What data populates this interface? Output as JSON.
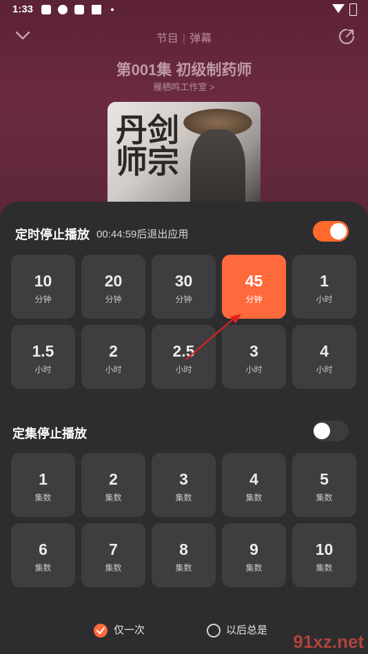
{
  "status_bar": {
    "time": "1:33"
  },
  "header": {
    "tabs": [
      "节目",
      "弹幕"
    ],
    "episode_title": "第001集 初级制药师",
    "studio": "雁栖鸣工作室 >"
  },
  "cover": {
    "title_text": "丹剑\n师宗"
  },
  "timer_section": {
    "title": "定时停止播放",
    "status": "00:44:59后退出应用",
    "toggle_on": true,
    "options": [
      {
        "num": "10",
        "unit": "分钟",
        "selected": false
      },
      {
        "num": "20",
        "unit": "分钟",
        "selected": false
      },
      {
        "num": "30",
        "unit": "分钟",
        "selected": false
      },
      {
        "num": "45",
        "unit": "分钟",
        "selected": true
      },
      {
        "num": "1",
        "unit": "小时",
        "selected": false
      },
      {
        "num": "1.5",
        "unit": "小时",
        "selected": false
      },
      {
        "num": "2",
        "unit": "小时",
        "selected": false
      },
      {
        "num": "2.5",
        "unit": "小时",
        "selected": false
      },
      {
        "num": "3",
        "unit": "小时",
        "selected": false
      },
      {
        "num": "4",
        "unit": "小时",
        "selected": false
      }
    ]
  },
  "episode_section": {
    "title": "定集停止播放",
    "toggle_on": false,
    "options": [
      {
        "num": "1",
        "unit": "集数"
      },
      {
        "num": "2",
        "unit": "集数"
      },
      {
        "num": "3",
        "unit": "集数"
      },
      {
        "num": "4",
        "unit": "集数"
      },
      {
        "num": "5",
        "unit": "集数"
      },
      {
        "num": "6",
        "unit": "集数"
      },
      {
        "num": "7",
        "unit": "集数"
      },
      {
        "num": "8",
        "unit": "集数"
      },
      {
        "num": "9",
        "unit": "集数"
      },
      {
        "num": "10",
        "unit": "集数"
      }
    ]
  },
  "footer": {
    "once_label": "仅一次",
    "always_label": "以后总是"
  },
  "watermark": "91xz.net",
  "colors": {
    "accent": "#ff6a3c",
    "sheet": "#2d2d2f",
    "cell": "#3e3e41"
  }
}
